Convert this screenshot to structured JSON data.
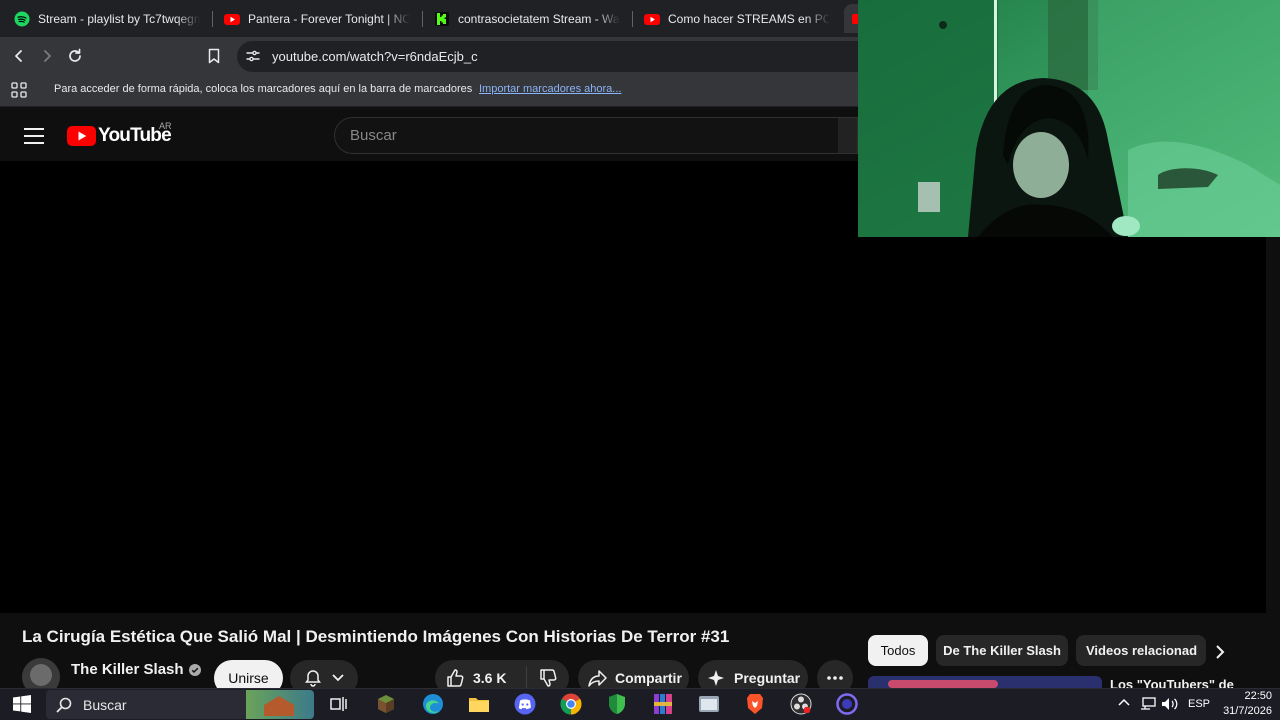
{
  "browser": {
    "tabs": [
      {
        "title": "Stream - playlist by Tc7twqegm4",
        "icon": "spotify-icon"
      },
      {
        "title": "Pantera - Forever Tonight | NO S",
        "icon": "youtube-favicon"
      },
      {
        "title": "contrasocietatem Stream - Watc",
        "icon": "kick-icon"
      },
      {
        "title": "Como hacer STREAMS en PC ba",
        "icon": "youtube-favicon"
      }
    ],
    "url": "youtube.com/watch?v=r6ndaEcjb_c",
    "bookmarks_hint": "Para acceder de forma rápida, coloca los marcadores aquí en la barra de marcadores",
    "bookmarks_link": "Importar marcadores ahora..."
  },
  "youtube": {
    "logo_text": "YouTube",
    "region": "AR",
    "search_placeholder": "Buscar",
    "video_title": "La Cirugía Estética Que Salió Mal | Desmintiendo Imágenes Con Historias De Terror #31",
    "channel_name": "The Killer Slash",
    "join_label": "Unirse",
    "like_count": "3.6 K",
    "share_label": "Compartir",
    "ask_label": "Preguntar",
    "chips": [
      "Todos",
      "De The Killer Slash",
      "Videos relacionad"
    ],
    "related_title": "Los \"YouTubers\" de"
  },
  "taskbar": {
    "search_label": "Buscar",
    "language": "ESP",
    "time": "22:50",
    "date": "31/7/2026"
  },
  "colors": {
    "youtube_red": "#ff0000",
    "chip_selected": "#f1f1f1",
    "link_blue": "#8ab4f8"
  }
}
